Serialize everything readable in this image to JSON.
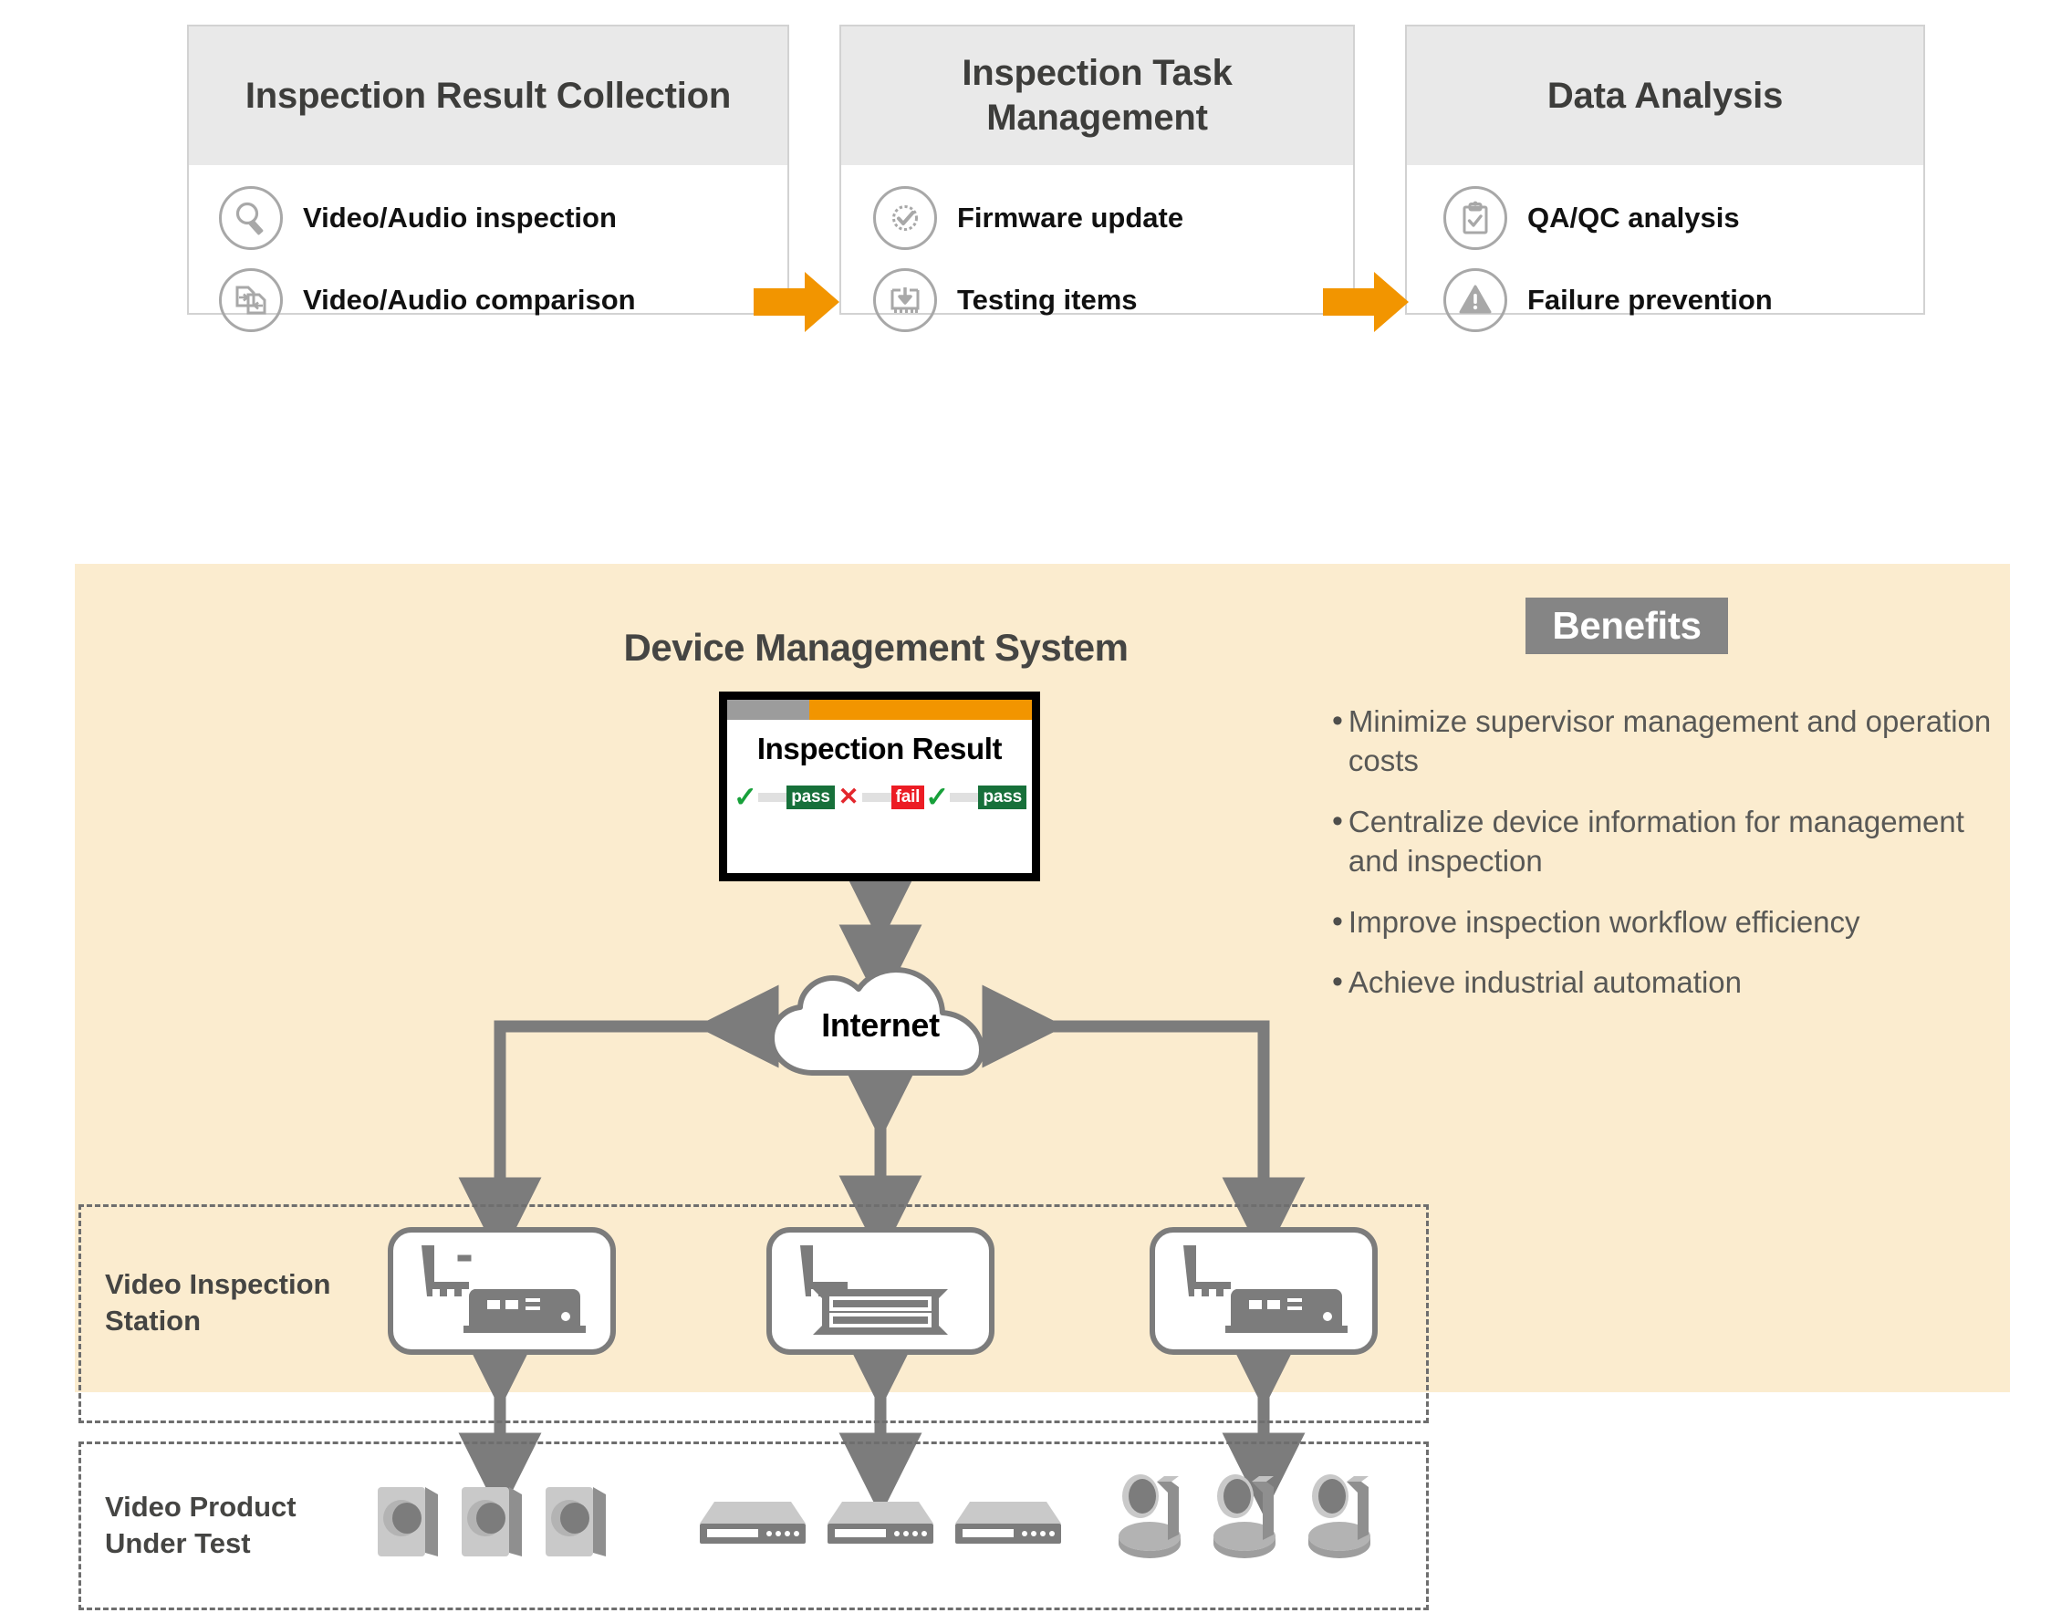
{
  "flow": {
    "arrow_color": "#f29500",
    "cards": [
      {
        "title": "Inspection Result\nCollection",
        "items": [
          {
            "icon": "magnifier-icon",
            "label": "Video/Audio inspection"
          },
          {
            "icon": "document-compare-icon",
            "label": "Video/Audio comparison"
          }
        ]
      },
      {
        "title": "Inspection Task\nManagement",
        "items": [
          {
            "icon": "gear-check-icon",
            "label": "Firmware update"
          },
          {
            "icon": "chip-download-icon",
            "label": "Testing items"
          }
        ]
      },
      {
        "title": "Data Analysis",
        "items": [
          {
            "icon": "clipboard-check-icon",
            "label": "QA/QC analysis"
          },
          {
            "icon": "warning-triangle-icon",
            "label": "Failure prevention"
          }
        ]
      }
    ]
  },
  "diagram": {
    "panel_bg": "#fbeccf",
    "title": "Device Management System",
    "monitor": {
      "screen_title": "Inspection Result",
      "titlebar_grey": "#9c9c9c",
      "titlebar_orange": "#f29500",
      "results": [
        {
          "mark": "✓",
          "badge": "pass",
          "badge_color": "#17703a"
        },
        {
          "mark": "✕",
          "badge": "fail",
          "badge_color": "#ec1c24"
        },
        {
          "mark": "✓",
          "badge": "pass",
          "badge_color": "#17703a"
        }
      ]
    },
    "cloud_label": "Internet",
    "groups": [
      {
        "name": "station-group",
        "label": "Video Inspection\nStation"
      },
      {
        "name": "product-group",
        "label": "Video Product\nUnder Test"
      }
    ],
    "stations": [
      {
        "icon": "pc-card-server-icon"
      },
      {
        "icon": "pc-card-rackmount-icon"
      },
      {
        "icon": "pc-card-server-icon"
      }
    ],
    "devices": [
      {
        "group": "camera-group",
        "icon": "box-camera-icon",
        "count": 3
      },
      {
        "group": "settop-group",
        "icon": "set-top-box-icon",
        "count": 3
      },
      {
        "group": "ptz-group",
        "icon": "ptz-camera-icon",
        "count": 3
      }
    ]
  },
  "benefits": {
    "heading": "Benefits",
    "heading_bg": "#858585",
    "bullet_char": "•",
    "items": [
      "Minimize supervisor management and operation costs",
      "Centralize device information for management and inspection",
      "Improve inspection workflow efficiency",
      "Achieve industrial automation"
    ]
  }
}
